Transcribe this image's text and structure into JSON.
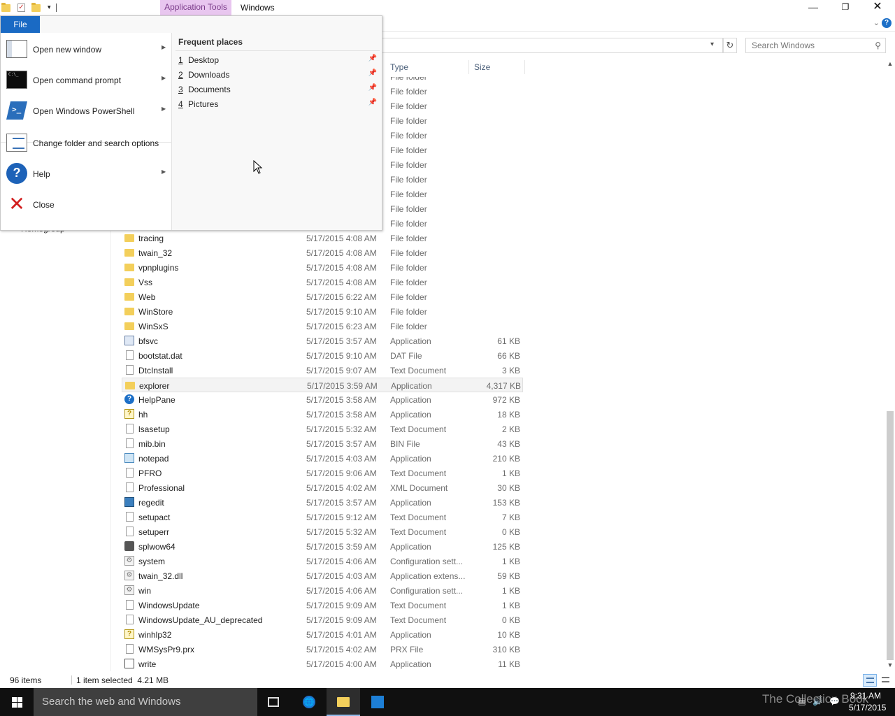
{
  "window": {
    "context_tab": "Application Tools",
    "title": "Windows",
    "search_placeholder": "Search Windows"
  },
  "columns": {
    "type": "Type",
    "size": "Size"
  },
  "nav_remnant": "Homegroup",
  "file_menu": {
    "tab_label": "File",
    "items": [
      {
        "label": "Open new window",
        "icon": "new-window-icon",
        "submenu": true
      },
      {
        "label": "Open command prompt",
        "icon": "command-prompt-icon",
        "submenu": true
      },
      {
        "label": "Open Windows PowerShell",
        "icon": "powershell-icon",
        "submenu": true
      },
      {
        "label": "Change folder and search options",
        "icon": "folder-options-icon",
        "submenu": false
      },
      {
        "label": "Help",
        "icon": "help-icon",
        "submenu": true
      },
      {
        "label": "Close",
        "icon": "close-icon",
        "submenu": false
      }
    ],
    "frequent_title": "Frequent places",
    "frequent": [
      {
        "num": "1",
        "name": "Desktop"
      },
      {
        "num": "2",
        "name": "Downloads"
      },
      {
        "num": "3",
        "name": "Documents"
      },
      {
        "num": "4",
        "name": "Pictures"
      }
    ]
  },
  "files": [
    {
      "name": "",
      "date": "",
      "type": "File folder",
      "size": "",
      "icon": "folder"
    },
    {
      "name": "",
      "date": "",
      "type": "File folder",
      "size": "",
      "icon": "folder"
    },
    {
      "name": "",
      "date": "",
      "type": "File folder",
      "size": "",
      "icon": "folder"
    },
    {
      "name": "",
      "date": "",
      "type": "File folder",
      "size": "",
      "icon": "folder"
    },
    {
      "name": "",
      "date": "",
      "type": "File folder",
      "size": "",
      "icon": "folder"
    },
    {
      "name": "",
      "date": "",
      "type": "File folder",
      "size": "",
      "icon": "folder"
    },
    {
      "name": "",
      "date": "",
      "type": "File folder",
      "size": "",
      "icon": "folder"
    },
    {
      "name": "",
      "date": "",
      "type": "File folder",
      "size": "",
      "icon": "folder"
    },
    {
      "name": "",
      "date": "",
      "type": "File folder",
      "size": "",
      "icon": "folder"
    },
    {
      "name": "",
      "date": "",
      "type": "File folder",
      "size": "",
      "icon": "folder"
    },
    {
      "name": "",
      "date": "",
      "type": "File folder",
      "size": "",
      "icon": "folder"
    },
    {
      "name": "tracing",
      "date": "5/17/2015 4:08 AM",
      "type": "File folder",
      "size": "",
      "icon": "folder"
    },
    {
      "name": "twain_32",
      "date": "5/17/2015 4:08 AM",
      "type": "File folder",
      "size": "",
      "icon": "folder"
    },
    {
      "name": "vpnplugins",
      "date": "5/17/2015 4:08 AM",
      "type": "File folder",
      "size": "",
      "icon": "folder"
    },
    {
      "name": "Vss",
      "date": "5/17/2015 4:08 AM",
      "type": "File folder",
      "size": "",
      "icon": "folder"
    },
    {
      "name": "Web",
      "date": "5/17/2015 6:22 AM",
      "type": "File folder",
      "size": "",
      "icon": "folder"
    },
    {
      "name": "WinStore",
      "date": "5/17/2015 9:10 AM",
      "type": "File folder",
      "size": "",
      "icon": "folder"
    },
    {
      "name": "WinSxS",
      "date": "5/17/2015 6:23 AM",
      "type": "File folder",
      "size": "",
      "icon": "folder"
    },
    {
      "name": "bfsvc",
      "date": "5/17/2015 3:57 AM",
      "type": "Application",
      "size": "61 KB",
      "icon": "app"
    },
    {
      "name": "bootstat.dat",
      "date": "5/17/2015 9:10 AM",
      "type": "DAT File",
      "size": "66 KB",
      "icon": "file"
    },
    {
      "name": "DtcInstall",
      "date": "5/17/2015 9:07 AM",
      "type": "Text Document",
      "size": "3 KB",
      "icon": "file"
    },
    {
      "name": "explorer",
      "date": "5/17/2015 3:59 AM",
      "type": "Application",
      "size": "4,317 KB",
      "icon": "explorer",
      "selected": true
    },
    {
      "name": "HelpPane",
      "date": "5/17/2015 3:58 AM",
      "type": "Application",
      "size": "972 KB",
      "icon": "help"
    },
    {
      "name": "hh",
      "date": "5/17/2015 3:58 AM",
      "type": "Application",
      "size": "18 KB",
      "icon": "hh"
    },
    {
      "name": "lsasetup",
      "date": "5/17/2015 5:32 AM",
      "type": "Text Document",
      "size": "2 KB",
      "icon": "file"
    },
    {
      "name": "mib.bin",
      "date": "5/17/2015 3:57 AM",
      "type": "BIN File",
      "size": "43 KB",
      "icon": "file"
    },
    {
      "name": "notepad",
      "date": "5/17/2015 4:03 AM",
      "type": "Application",
      "size": "210 KB",
      "icon": "notepad"
    },
    {
      "name": "PFRO",
      "date": "5/17/2015 9:06 AM",
      "type": "Text Document",
      "size": "1 KB",
      "icon": "file"
    },
    {
      "name": "Professional",
      "date": "5/17/2015 4:02 AM",
      "type": "XML Document",
      "size": "30 KB",
      "icon": "xml"
    },
    {
      "name": "regedit",
      "date": "5/17/2015 3:57 AM",
      "type": "Application",
      "size": "153 KB",
      "icon": "regedit"
    },
    {
      "name": "setupact",
      "date": "5/17/2015 9:12 AM",
      "type": "Text Document",
      "size": "7 KB",
      "icon": "file"
    },
    {
      "name": "setuperr",
      "date": "5/17/2015 5:32 AM",
      "type": "Text Document",
      "size": "0 KB",
      "icon": "file"
    },
    {
      "name": "splwow64",
      "date": "5/17/2015 3:59 AM",
      "type": "Application",
      "size": "125 KB",
      "icon": "print"
    },
    {
      "name": "system",
      "date": "5/17/2015 4:06 AM",
      "type": "Configuration sett...",
      "size": "1 KB",
      "icon": "gear"
    },
    {
      "name": "twain_32.dll",
      "date": "5/17/2015 4:03 AM",
      "type": "Application extens...",
      "size": "59 KB",
      "icon": "gear"
    },
    {
      "name": "win",
      "date": "5/17/2015 4:06 AM",
      "type": "Configuration sett...",
      "size": "1 KB",
      "icon": "gear"
    },
    {
      "name": "WindowsUpdate",
      "date": "5/17/2015 9:09 AM",
      "type": "Text Document",
      "size": "1 KB",
      "icon": "file"
    },
    {
      "name": "WindowsUpdate_AU_deprecated",
      "date": "5/17/2015 9:09 AM",
      "type": "Text Document",
      "size": "0 KB",
      "icon": "file"
    },
    {
      "name": "winhlp32",
      "date": "5/17/2015 4:01 AM",
      "type": "Application",
      "size": "10 KB",
      "icon": "hh"
    },
    {
      "name": "WMSysPr9.prx",
      "date": "5/17/2015 4:02 AM",
      "type": "PRX File",
      "size": "310 KB",
      "icon": "file"
    },
    {
      "name": "write",
      "date": "5/17/2015 4:00 AM",
      "type": "Application",
      "size": "11 KB",
      "icon": "write"
    }
  ],
  "status": {
    "items": "96 items",
    "selection": "1 item selected  4.21 MB"
  },
  "taskbar": {
    "search_placeholder": "Search the web and Windows",
    "watermark": "The Collection Book",
    "time": "9:31 AM",
    "date": "5/17/2015"
  }
}
